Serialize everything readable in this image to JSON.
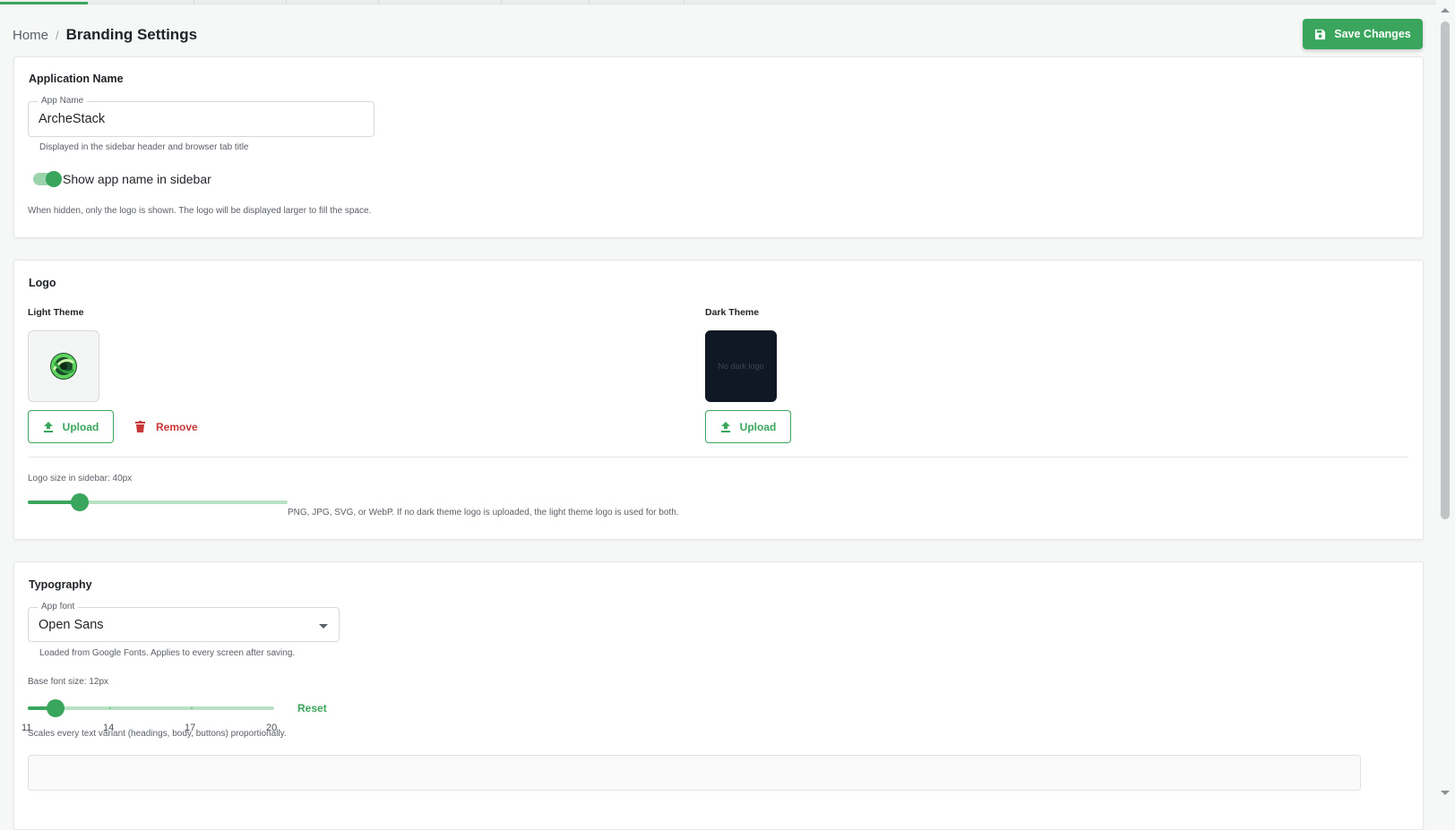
{
  "breadcrumb": {
    "home": "Home",
    "separator": "/",
    "current": "Branding Settings"
  },
  "save_button": {
    "label": "Save Changes",
    "icon": "save-icon"
  },
  "application_name": {
    "title": "Application Name",
    "app_name_field": {
      "label": "App Name",
      "value": "ArcheStack"
    },
    "helper": "Displayed in the sidebar header and browser tab title",
    "toggle": {
      "label": "Show app name in sidebar",
      "on": true
    },
    "toggle_helper": "When hidden, only the logo is shown. The logo will be displayed larger to fill the space."
  },
  "logo": {
    "title": "Logo",
    "light_theme": {
      "label": "Light Theme",
      "upload": "Upload",
      "remove": "Remove"
    },
    "dark_theme": {
      "label": "Dark Theme",
      "placeholder": "No dark logo",
      "upload": "Upload"
    },
    "size_label": "Logo size in sidebar: 40px",
    "size_value": 40,
    "size_fraction": 0.2,
    "formats_note": "PNG, JPG, SVG, or WebP. If no dark theme logo is uploaded, the light theme logo is used for both."
  },
  "typography": {
    "title": "Typography",
    "font_field": {
      "label": "App font",
      "value": "Open Sans"
    },
    "font_helper": "Loaded from Google Fonts. Applies to every screen after saving.",
    "base_size_label": "Base font size: 12px",
    "base_size_value": 12,
    "ticks": [
      "11",
      "14",
      "17",
      "20"
    ],
    "reset": "Reset",
    "scale_helper": "Scales every text variant (headings, body, buttons) proportionally."
  },
  "colors": {
    "accent": "#3aa55c",
    "danger": "#c93838",
    "dark_logo_bg": "#0f1824"
  }
}
